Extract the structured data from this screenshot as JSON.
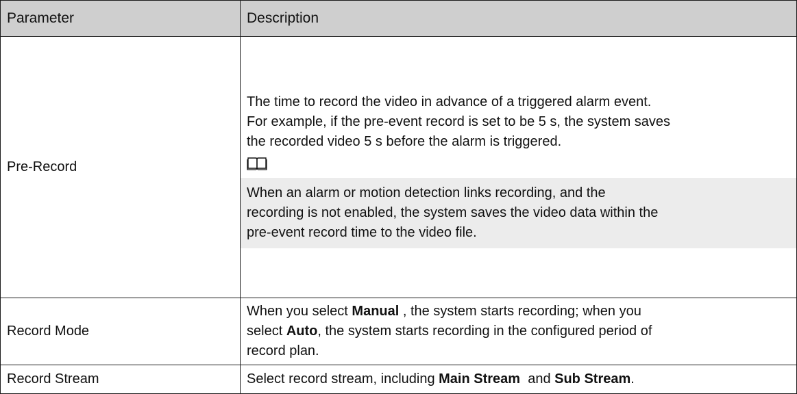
{
  "table": {
    "headers": {
      "parameter": "Parameter",
      "description": "Description"
    },
    "rows": [
      {
        "parameter": "Pre-Record",
        "description_lines": [
          "The time to record the video in advance of a triggered alarm event.",
          "For example, if the pre-event record is set to be 5 s, the system saves",
          "the recorded video 5 s before the alarm is triggered."
        ],
        "note_icon": "book-icon",
        "note_lines": [
          "When an alarm or motion detection links recording, and the",
          "recording is not enabled, the system saves the video data within the",
          "pre-event record time to the video file."
        ]
      },
      {
        "parameter": "Record Mode",
        "description_parts": [
          "When you select ",
          "Manual",
          " , the system starts recording; when you",
          "select ",
          "Auto",
          ", the system starts recording in the configured period of",
          "record plan."
        ]
      },
      {
        "parameter": "Record Stream",
        "description_parts": [
          "Select record stream, including ",
          "Main Stream",
          "  and ",
          "Sub Stream",
          "."
        ]
      }
    ]
  }
}
